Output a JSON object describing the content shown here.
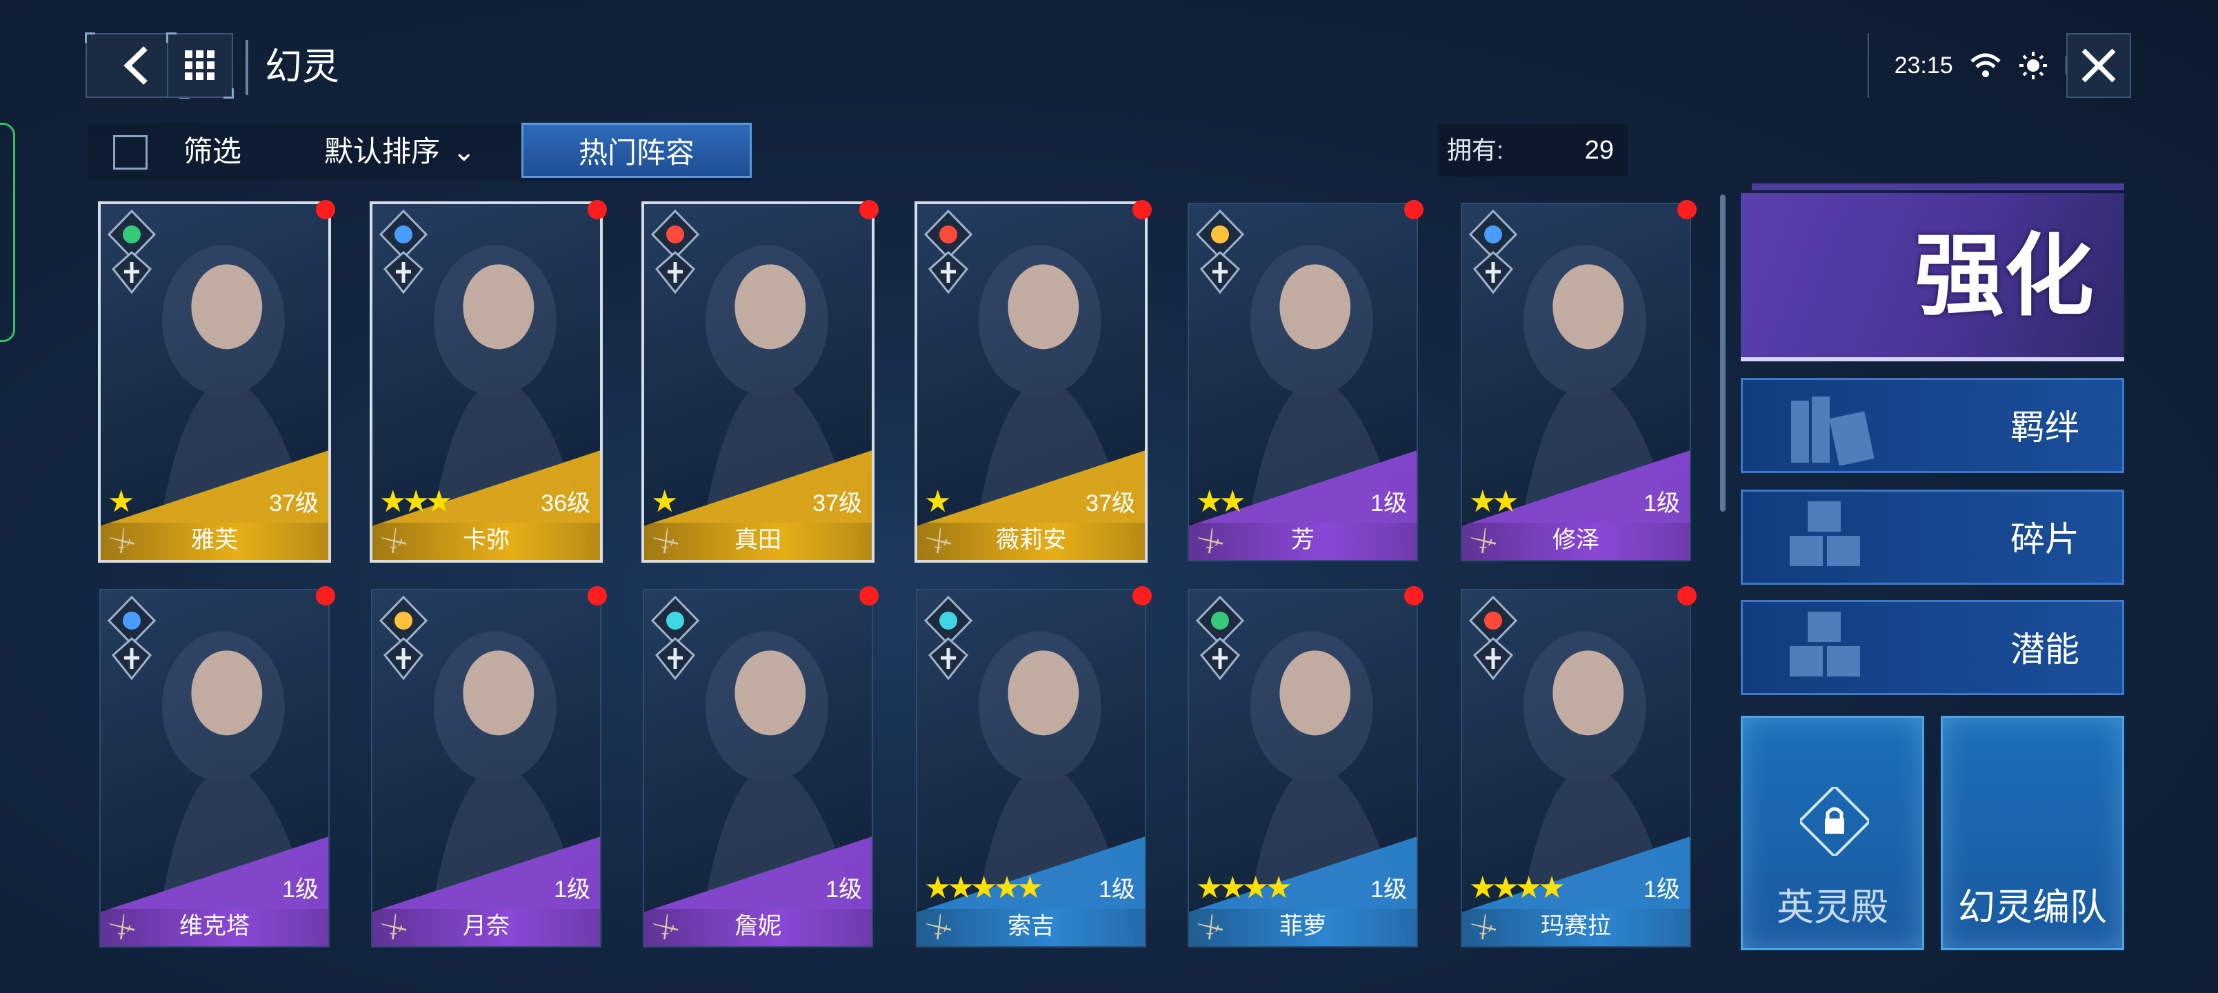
{
  "header": {
    "back_icon": "chevron-left-icon",
    "menu_icon": "grid-icon",
    "title": "幻灵",
    "time": "23:15",
    "close_icon": "close-icon"
  },
  "toolbar": {
    "filter_label": "筛选",
    "sort_label": "默认排序",
    "hot_label": "热门阵容",
    "own_label": "拥有:",
    "own_count": "29"
  },
  "cards": [
    {
      "name": "雅芙",
      "level": "37级",
      "stars": "★",
      "rarity": "gold",
      "element": "wind"
    },
    {
      "name": "卡弥",
      "level": "36级",
      "stars": "★★★",
      "rarity": "gold",
      "element": "ice"
    },
    {
      "name": "真田",
      "level": "37级",
      "stars": "★",
      "rarity": "gold",
      "element": "fire"
    },
    {
      "name": "薇莉安",
      "level": "37级",
      "stars": "★",
      "rarity": "gold",
      "element": "fire"
    },
    {
      "name": "芳",
      "level": "1级",
      "stars": "★★",
      "rarity": "purple",
      "element": "light"
    },
    {
      "name": "修泽",
      "level": "1级",
      "stars": "★★",
      "rarity": "purple",
      "element": "ice"
    },
    {
      "name": "维克塔",
      "level": "1级",
      "stars": "",
      "rarity": "purple",
      "element": "ice"
    },
    {
      "name": "月奈",
      "level": "1级",
      "stars": "",
      "rarity": "purple",
      "element": "light"
    },
    {
      "name": "詹妮",
      "level": "1级",
      "stars": "",
      "rarity": "purple",
      "element": "water"
    },
    {
      "name": "索吉",
      "level": "1级",
      "stars": "★★★★★",
      "rarity": "blue",
      "element": "water"
    },
    {
      "name": "菲萝",
      "level": "1级",
      "stars": "★★★★",
      "rarity": "blue",
      "element": "wind"
    },
    {
      "name": "玛赛拉",
      "level": "1级",
      "stars": "★★★★",
      "rarity": "blue",
      "element": "fire"
    }
  ],
  "side": {
    "enhance": "强化",
    "bond": "羁绊",
    "fragment": "碎片",
    "potential": "潜能",
    "hall": "英灵殿",
    "team": "幻灵编队"
  },
  "colors": {
    "gold": "#e7ae17",
    "purple": "#8a48d6",
    "blue": "#2c86d1",
    "enhance": "#5a3fb0",
    "hot": "#2e6ab8",
    "badge": "#ff1e1e"
  }
}
